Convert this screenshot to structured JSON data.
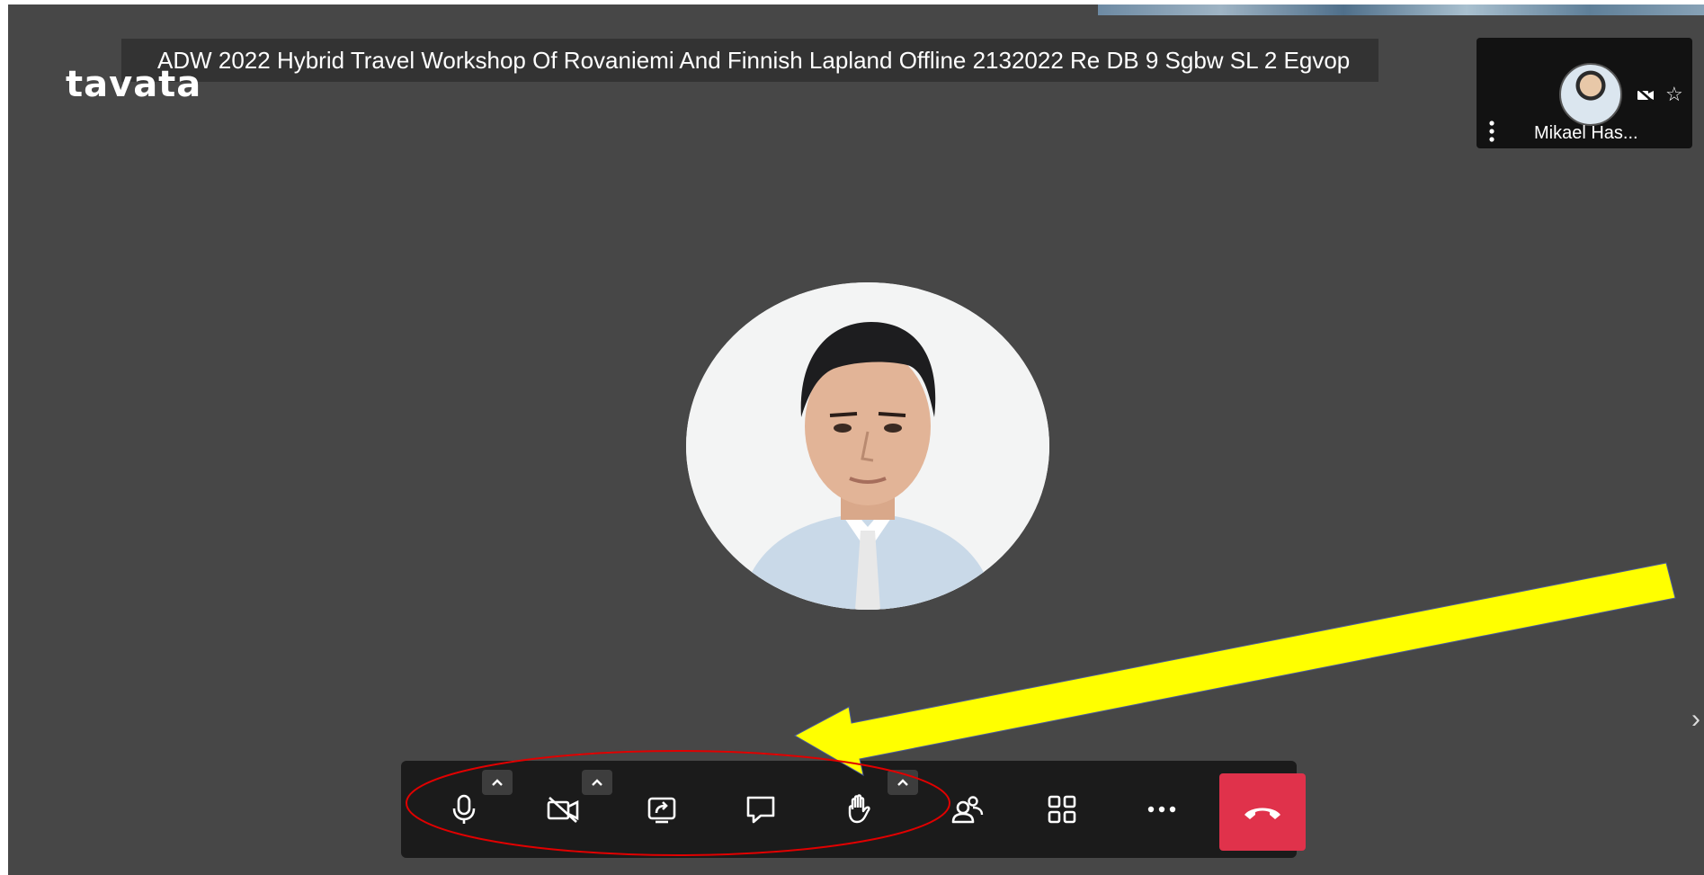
{
  "meeting": {
    "title": "ADW 2022 Hybrid Travel Workshop Of Rovaniemi And Finnish Lapland Offline 2132022 Re DB 9 Sgbw SL 2 Egvop"
  },
  "brand": {
    "logo_text": "tavata"
  },
  "participant_tile": {
    "name": "Mikael Has...",
    "camera_state": "off",
    "icons": [
      "avatar",
      "camera-off-icon",
      "star-icon",
      "more-vertical-icon"
    ]
  },
  "toolbar": {
    "buttons": [
      {
        "icon": "microphone-icon",
        "has_options_caret": true
      },
      {
        "icon": "camera-off-icon",
        "has_options_caret": true
      },
      {
        "icon": "share-screen-icon",
        "has_options_caret": false
      },
      {
        "icon": "chat-icon",
        "has_options_caret": false
      },
      {
        "icon": "raise-hand-icon",
        "has_options_caret": true
      },
      {
        "icon": "participants-icon",
        "has_options_caret": false
      },
      {
        "icon": "tile-view-icon",
        "has_options_caret": false
      },
      {
        "icon": "more-icon",
        "has_options_caret": false
      },
      {
        "icon": "hang-up-icon",
        "has_options_caret": false
      }
    ]
  },
  "annotations": {
    "arrow_color": "#ffff00",
    "ellipse_color": "#e00000"
  },
  "colors": {
    "stage_background": "#474747",
    "toolbar_background": "#1b1b1b",
    "hangup_red": "#e0324b"
  }
}
